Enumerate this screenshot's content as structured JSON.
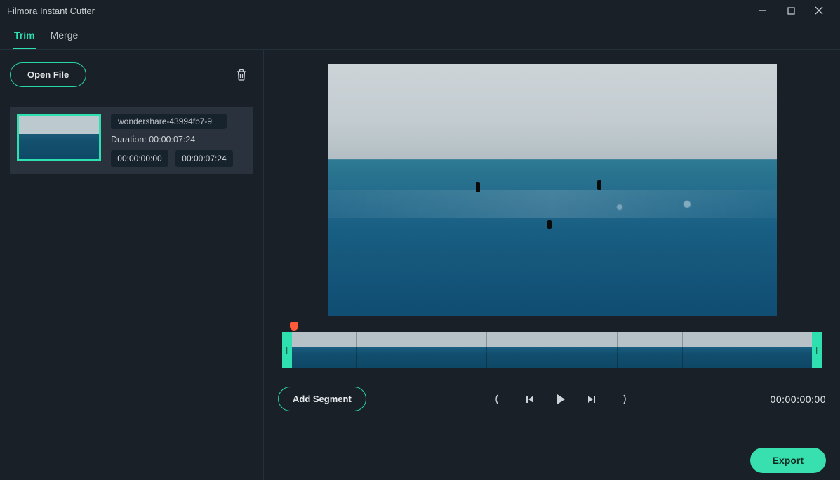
{
  "window": {
    "title": "Filmora Instant Cutter"
  },
  "tabs": {
    "trim": "Trim",
    "merge": "Merge"
  },
  "sidebar": {
    "open_file_label": "Open File",
    "clip": {
      "filename": "wondershare-43994fb7-9",
      "duration_label": "Duration: 00:00:07:24",
      "start_time": "00:00:00:00",
      "end_time": "00:00:07:24"
    }
  },
  "controls": {
    "add_segment_label": "Add Segment",
    "current_time": "00:00:00:00"
  },
  "export": {
    "label": "Export"
  },
  "icons": {
    "trash": "trash",
    "minimize": "minimize",
    "maximize": "maximize",
    "close": "close"
  }
}
